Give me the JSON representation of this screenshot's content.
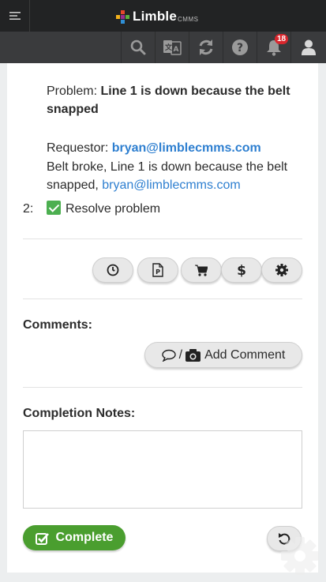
{
  "app": {
    "logo_text": "Limble",
    "logo_sub": "CMMS"
  },
  "toolbar": {
    "notification_count": "18"
  },
  "task": {
    "problem_label": "Problem: ",
    "problem_value": "Line 1 is down because the belt snapped",
    "requestor_label": "Requestor: ",
    "requestor_email": "bryan@limblecmms.com",
    "description_text": "Belt broke, Line 1 is down because the belt snapped, ",
    "description_email": "bryan@limblecmms.com",
    "step_number": "2:",
    "step_label": "Resolve problem"
  },
  "comments": {
    "heading": "Comments:",
    "add_label": "Add Comment",
    "separator": "/"
  },
  "completion": {
    "heading": "Completion Notes:",
    "notes_value": "",
    "complete_label": "Complete"
  },
  "colors": {
    "topbar": "#222324",
    "toolbar": "#3a3b3d",
    "link": "#2e7fd0",
    "complete": "#4a9e2f",
    "badge": "#d9262d",
    "check": "#4caf50"
  }
}
